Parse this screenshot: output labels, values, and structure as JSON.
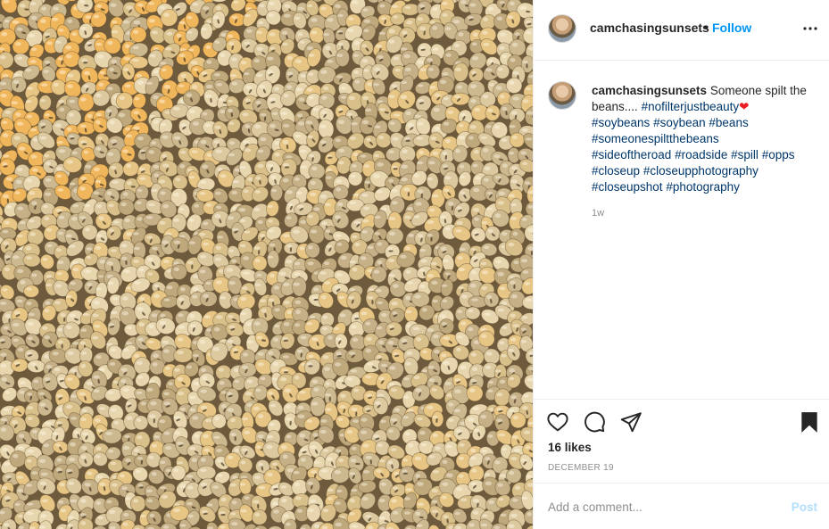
{
  "photo": {
    "subject": "soybeans",
    "palette": [
      "#e6c585",
      "#dcc9a0",
      "#cdb98f",
      "#c6b088",
      "#d9bf8a",
      "#bfa87c",
      "#e8d6ae"
    ],
    "shadow": "#6e5a3c",
    "accent_warm": "#f0b65c"
  },
  "header": {
    "username": "camchasingsunsets",
    "separator": "•",
    "follow_label": "Follow",
    "more_icon": "more-options-icon"
  },
  "caption": {
    "username": "camchasingsunsets",
    "text": "Someone spilt the beans....",
    "first_tag": "#nofilterjustbeauty",
    "emoji": "❤",
    "tags": [
      "#soybeans",
      "#soybean",
      "#beans",
      "#someonespiltthebeans",
      "#sideoftheroad",
      "#roadside",
      "#spill",
      "#opps",
      "#closeup",
      "#closeupphotography",
      "#closeupshot",
      "#photography"
    ],
    "age": "1w"
  },
  "actions": {
    "like_icon": "heart-outline-icon",
    "comment_icon": "comment-bubble-icon",
    "share_icon": "paper-plane-icon",
    "save_icon": "bookmark-filled-icon",
    "likes": "16 likes",
    "date": "December 19"
  },
  "comment": {
    "placeholder": "Add a comment...",
    "post_label": "Post"
  },
  "colors": {
    "link_blue": "#0095f6",
    "hashtag": "#00376b",
    "muted": "#8e8e8e",
    "post_disabled": "#b2dffc",
    "heart_red": "#ed1c24"
  }
}
